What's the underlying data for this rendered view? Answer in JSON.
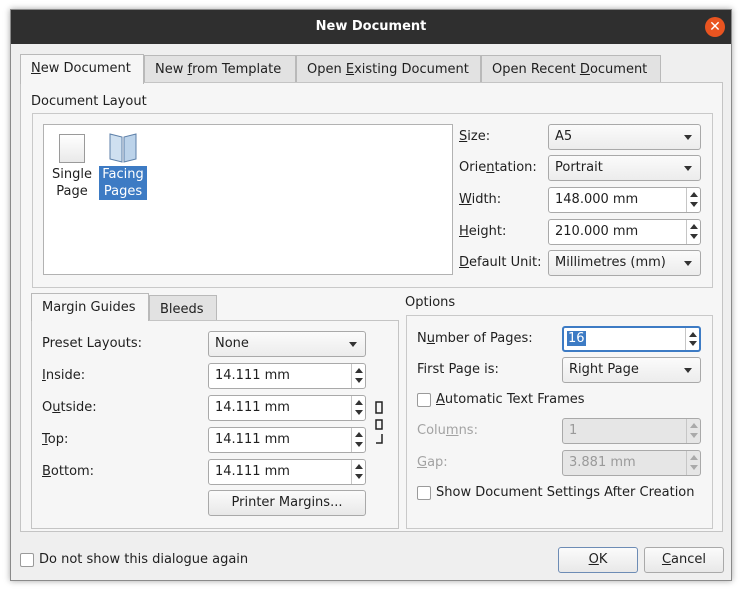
{
  "window": {
    "title": "New Document"
  },
  "tabs": [
    {
      "pre": "",
      "key": "N",
      "post": "ew Document",
      "active": true
    },
    {
      "pre": "New ",
      "key": "f",
      "post": "rom Template",
      "active": false
    },
    {
      "pre": "Open ",
      "key": "E",
      "post": "xisting Document",
      "active": false
    },
    {
      "pre": "Open Recent ",
      "key": "D",
      "post": "ocument",
      "active": false
    }
  ],
  "layout": {
    "group_title": "Document Layout",
    "single_line1": "Single",
    "single_line2": "Page",
    "facing_line1": "Facing",
    "facing_line2": "Pages"
  },
  "size": {
    "pre": "",
    "key": "S",
    "post": "ize:",
    "value": "A5"
  },
  "orientation": {
    "pre": "Orie",
    "key": "n",
    "post": "tation:",
    "value": "Portrait"
  },
  "width": {
    "pre": "",
    "key": "W",
    "post": "idth:",
    "value": "148.000 mm"
  },
  "height": {
    "pre": "",
    "key": "H",
    "post": "eight:",
    "value": "210.000 mm"
  },
  "unit": {
    "pre": "",
    "key": "D",
    "post": "efault Unit:",
    "value": "Millimetres (mm)"
  },
  "margin_tabs": {
    "guides": "Margin Guides",
    "bleeds": "Bleeds"
  },
  "margins": {
    "preset_label": "Preset Layouts:",
    "preset_value": "None",
    "inside": {
      "pre": "",
      "key": "I",
      "post": "nside:",
      "value": "14.111 mm"
    },
    "outside": {
      "pre": "O",
      "key": "u",
      "post": "tside:",
      "value": "14.111 mm"
    },
    "top": {
      "pre": "",
      "key": "T",
      "post": "op:",
      "value": "14.111 mm"
    },
    "bottom": {
      "pre": "",
      "key": "B",
      "post": "ottom:",
      "value": "14.111 mm"
    },
    "printer_button": "Printer Margins..."
  },
  "options": {
    "group_title": "Options",
    "pages": {
      "pre": "N",
      "key": "u",
      "post": "mber of Pages:",
      "value": "16"
    },
    "first_page_label": "First Page is:",
    "first_page_value": "Right Page",
    "auto_frames": {
      "pre": "",
      "key": "A",
      "post": "utomatic Text Frames"
    },
    "columns": {
      "pre": "Colu",
      "key": "m",
      "post": "ns:",
      "value": "1"
    },
    "gap": {
      "pre": "",
      "key": "G",
      "post": "ap:",
      "value": "3.881 mm"
    },
    "show_settings": "Show Document Settings After Creation"
  },
  "footer": {
    "dont_show": "Do not show this dialogue again",
    "ok": {
      "pre": "",
      "key": "O",
      "post": "K"
    },
    "cancel": {
      "pre": "",
      "key": "C",
      "post": "ancel"
    }
  },
  "colors": {
    "titlebar": "#2f2f2f",
    "close_button": "#e95420",
    "selection": "#3d7bc4"
  }
}
